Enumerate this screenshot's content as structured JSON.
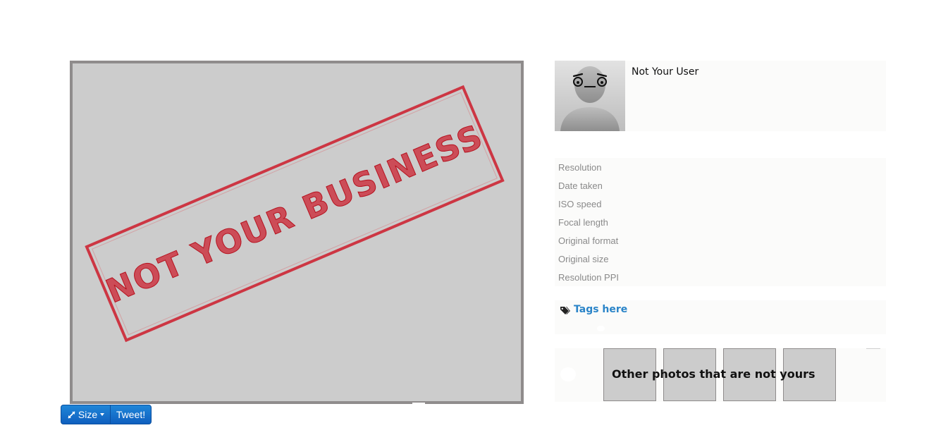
{
  "photo": {
    "stamp_text": "NOT YOUR BUSINESS",
    "background_color": "#cccccc",
    "frame_color": "#8f8c8c",
    "stamp_color": "#cc1b2a"
  },
  "toolbar": {
    "size_label": "Size",
    "size_icon": "resize-arrows-icon",
    "tweet_label": "Tweet!",
    "button_color": "#1675cf"
  },
  "user": {
    "name": "Not Your User",
    "avatar_icon": "silhouette-avatar-icon"
  },
  "metadata": {
    "fields": [
      {
        "label": "Resolution"
      },
      {
        "label": "Date taken"
      },
      {
        "label": "ISO speed"
      },
      {
        "label": "Focal length"
      },
      {
        "label": "Original format"
      },
      {
        "label": "Original size"
      },
      {
        "label": "Resolution PPI"
      }
    ]
  },
  "tags": {
    "icon": "tags-icon",
    "link_label": "Tags here",
    "link_color": "#2a84c8"
  },
  "others": {
    "title": "Other photos that are not yours",
    "thumbnails": [
      {
        "name": "thumb-1"
      },
      {
        "name": "thumb-2"
      },
      {
        "name": "thumb-3"
      },
      {
        "name": "thumb-4"
      }
    ]
  }
}
